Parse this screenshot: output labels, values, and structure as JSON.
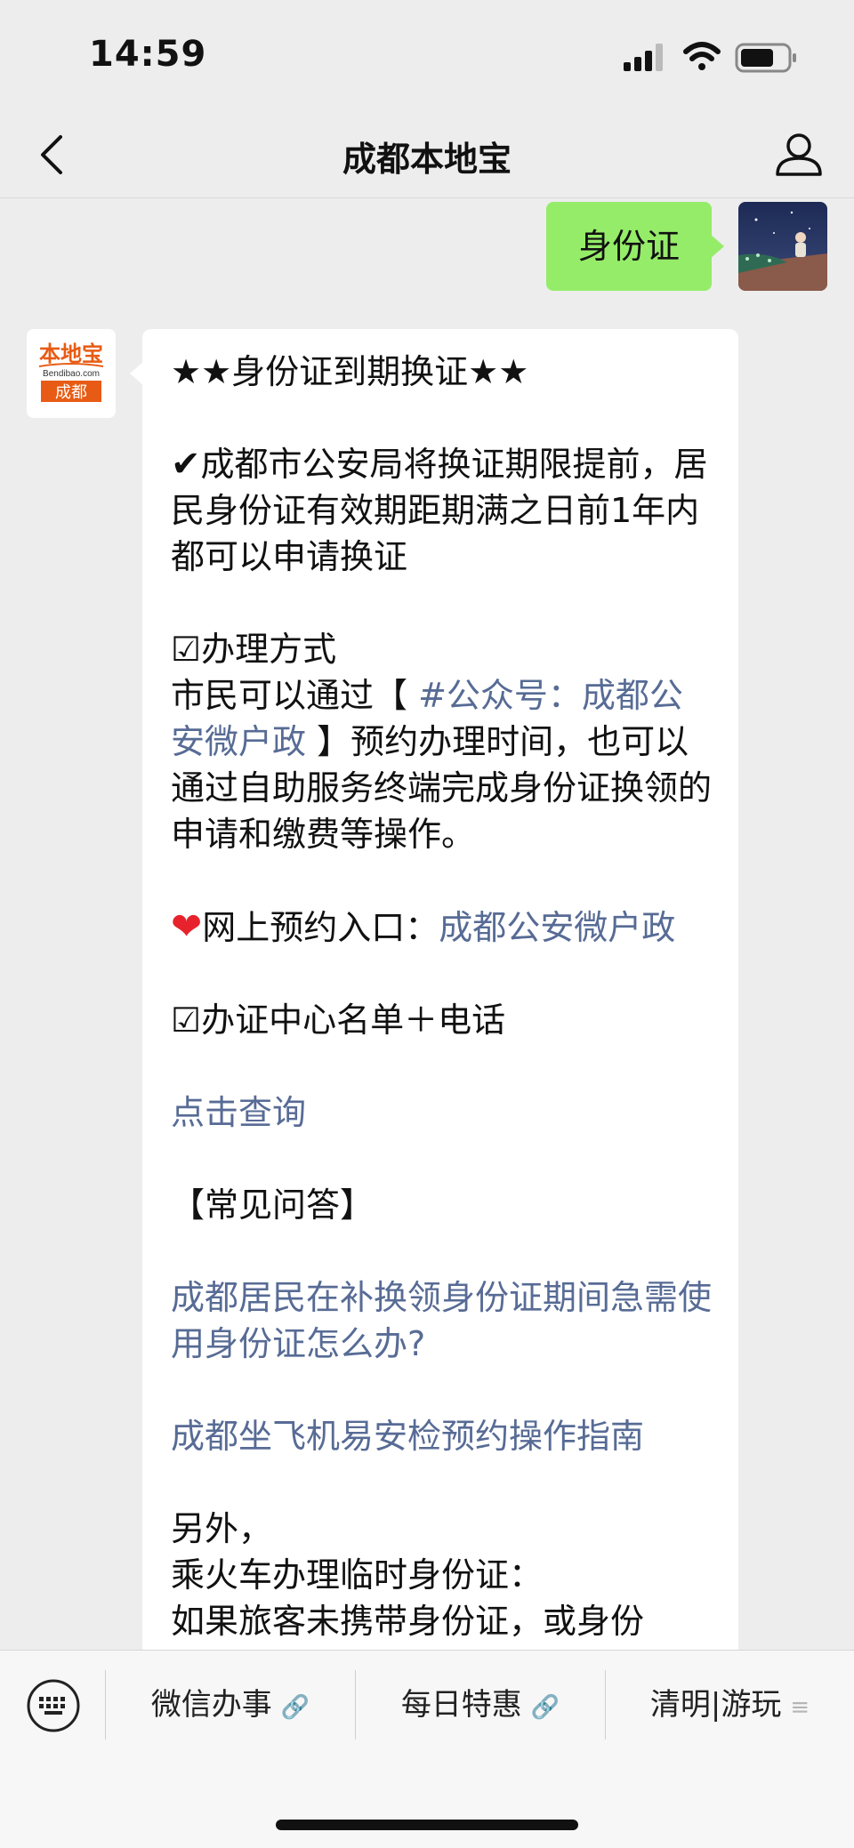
{
  "status": {
    "time": "14:59"
  },
  "nav": {
    "title": "成都本地宝"
  },
  "chat": {
    "user_message": "身份证",
    "bot_logo": {
      "line1": "本地宝",
      "line2": "Bendibao.com",
      "line3": "成都"
    },
    "bot_reply": {
      "heading": "★★身份证到期换证★★",
      "check_icon": "✔",
      "intro": "成都市公安局将换证期限提前，居民身份证有效期距期满之日前1年内都可以申请换证",
      "section1_title": "☑办理方式",
      "section1_prefix": "市民可以通过【",
      "section1_link": " #公众号：成都公安微户政 ",
      "section1_suffix": "】预约办理时间，也可以通过自助服务终端完成身份证换领的申请和缴费等操作。",
      "heart_icon": "❤",
      "booking_label": "网上预约入口：",
      "booking_link": "成都公安微户政",
      "section2_title": "☑办证中心名单＋电话",
      "query_link": "点击查询",
      "faq_title": "【常见问答】",
      "faq_link1": "成都居民在补换领身份证期间急需使用身份证怎么办?",
      "faq_link2": "成都坐飞机易安检预约操作指南",
      "extra_line1": "另外，",
      "extra_line2": "乘火车办理临时身份证：",
      "extra_line3": "如果旅客未携带身份证，或身份"
    }
  },
  "menu": {
    "items": [
      {
        "label": "微信办事",
        "icon": "link-icon"
      },
      {
        "label": "每日特惠",
        "icon": "link-icon"
      },
      {
        "label": "清明|游玩",
        "icon": "menu-lines-icon"
      }
    ]
  },
  "colors": {
    "user_bubble": "#95ec69",
    "link": "#576b95",
    "logo_orange": "#e85b14"
  }
}
